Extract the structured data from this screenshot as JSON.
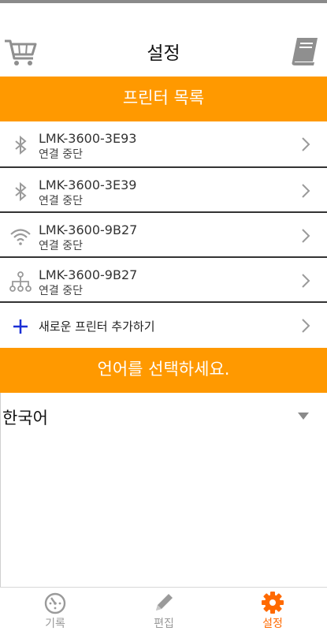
{
  "header": {
    "title": "설정",
    "cart_icon": "shopping-cart-icon",
    "book_icon": "book-icon"
  },
  "printers": {
    "section_title": "프린터 목록",
    "items": [
      {
        "name": "LMK-3600-3E93",
        "status": "연결 중단",
        "icon": "bluetooth-icon"
      },
      {
        "name": "LMK-3600-3E39",
        "status": "연결 중단",
        "icon": "bluetooth-icon"
      },
      {
        "name": "LMK-3600-9B27",
        "status": "연결 중단",
        "icon": "wifi-icon"
      },
      {
        "name": "LMK-3600-9B27",
        "status": "연결 중단",
        "icon": "network-icon"
      }
    ],
    "add_label": "새로운 프린터 추가하기"
  },
  "language": {
    "section_title": "언어를 선택하세요.",
    "selected": "한국어"
  },
  "tabbar": {
    "tabs": [
      {
        "label": "기록",
        "icon": "timer-icon",
        "active": false
      },
      {
        "label": "편집",
        "icon": "pencil-icon",
        "active": false
      },
      {
        "label": "설정",
        "icon": "gear-icon",
        "active": true
      }
    ]
  },
  "colors": {
    "accent": "#ff9900",
    "active_tab": "#ff6a00",
    "inactive_tab": "#9a9a9a",
    "add_plus": "#1a2fd6",
    "icon_gray": "#9a9a9a"
  }
}
